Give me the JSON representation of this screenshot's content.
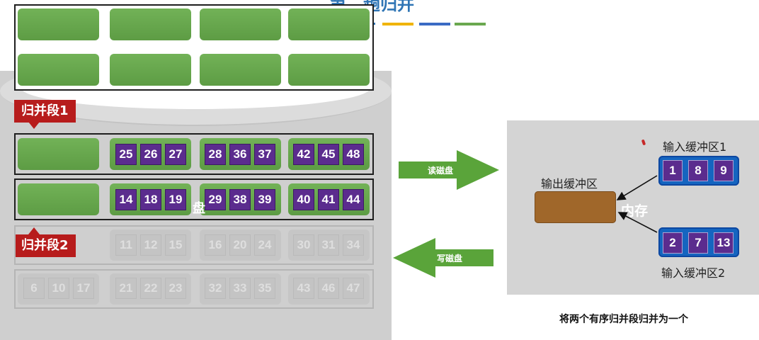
{
  "title": "第二趟归并",
  "colors": {
    "block_green": "#6aa84f",
    "cell_purple": "#5b2c8e",
    "label_red": "#b71c1c",
    "buffer_blue": "#1565c0",
    "output_brown": "#a0672a",
    "arrow_green": "#5aa43a",
    "dash_orange": "#f0b400",
    "dash_blue": "#3a6bc4",
    "dash_green": "#6aa84f"
  },
  "segments": {
    "seg1_label": "归并段1",
    "seg2_label": "归并段2"
  },
  "disk_rows": {
    "row1": [
      "25",
      "26",
      "27",
      "28",
      "36",
      "37",
      "42",
      "45",
      "48"
    ],
    "row2": [
      "14",
      "18",
      "19",
      "29",
      "38",
      "39",
      "40",
      "41",
      "44"
    ],
    "row3": [
      "11",
      "12",
      "15",
      "16",
      "20",
      "24",
      "30",
      "31",
      "34"
    ],
    "row4": [
      "6",
      "10",
      "17",
      "21",
      "22",
      "23",
      "32",
      "33",
      "35",
      "43",
      "46",
      "47"
    ]
  },
  "arrows": {
    "read_label": "读磁盘",
    "write_label": "写磁盘"
  },
  "memory": {
    "label": "内存",
    "output_buffer_label": "输出缓冲区",
    "input_buffer1_label": "输入缓冲区1",
    "input_buffer2_label": "输入缓冲区2",
    "input_buffer1": [
      "1",
      "8",
      "9"
    ],
    "input_buffer2": [
      "2",
      "7",
      "13"
    ]
  },
  "caption": "将两个有序归并段归并为一个",
  "partial_text": "盘"
}
